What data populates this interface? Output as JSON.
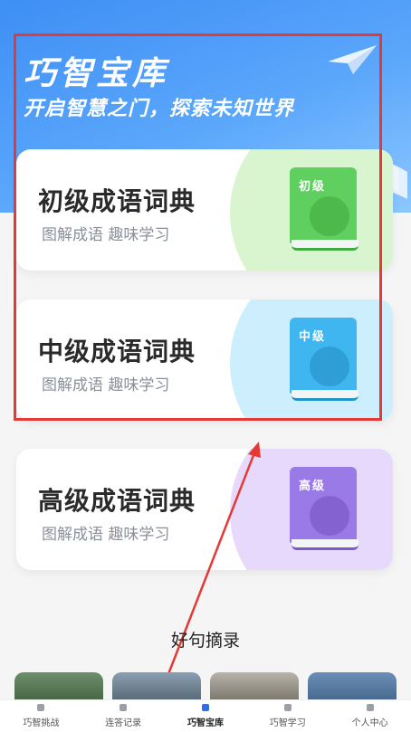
{
  "hero": {
    "title": "巧智宝库",
    "subtitle": "开启智慧之门，探索未知世界"
  },
  "cards": [
    {
      "title": "初级成语词典",
      "subtitle": "图解成语 趣味学习",
      "badge": "初级",
      "color": "#5fcf5f",
      "accent": "#d9f5cf"
    },
    {
      "title": "中级成语词典",
      "subtitle": "图解成语 趣味学习",
      "badge": "中级",
      "color": "#3fb6f0",
      "accent": "#cdeefc"
    },
    {
      "title": "高级成语词典",
      "subtitle": "图解成语 趣味学习",
      "badge": "高级",
      "color": "#9a7ae6",
      "accent": "#e6d9fb"
    }
  ],
  "quotes": {
    "title": "好句摘录"
  },
  "tabbar": {
    "items": [
      {
        "label": "巧智挑战",
        "icon": "close-icon"
      },
      {
        "label": "连答记录",
        "icon": "pen-icon"
      },
      {
        "label": "巧智宝库",
        "icon": "book-icon",
        "active": true
      },
      {
        "label": "巧智学习",
        "icon": "document-icon"
      },
      {
        "label": "个人中心",
        "icon": "user-icon"
      }
    ]
  }
}
